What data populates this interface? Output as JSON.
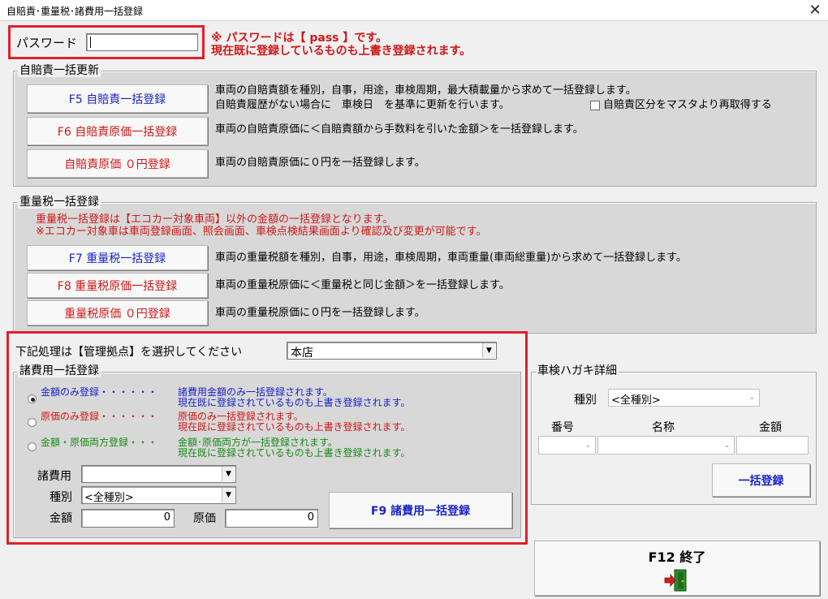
{
  "window": {
    "title": "自賠責･重量税･諸費用一括登録",
    "close_glyph": "✕"
  },
  "password": {
    "label": "パスワード",
    "value": "",
    "note_line1": "※ パスワードは【 pass 】です。",
    "note_line2": "現在既に登録しているものも上書き登録されます。"
  },
  "jibaiseki": {
    "legend": "自賠責一括更新",
    "f5_label": "F5 自賠責一括登録",
    "f6_label": "F6 自賠責原価一括登録",
    "zero_label": "自賠責原価 ０円登録",
    "desc_f5_line1": "車両の自賠責額を種別，自事，用途，車検周期，最大積載量から求めて一括登録します。",
    "desc_f5_line2": "自賠責履歴がない場合に　車検日　を基準に更新を行います。",
    "checkbox_label": "自賠責区分をマスタより再取得する",
    "checkbox_checked": false,
    "desc_f6": "車両の自賠責原価に＜自賠責額から手数料を引いた金額＞を一括登録します。",
    "desc_zero": "車両の自賠責原価に０円を一括登録します。"
  },
  "juryozei": {
    "legend": "重量税一括登録",
    "warning_line1": "重量税一括登録は【エコカー対象車両】以外の金額の一括登録となります。",
    "warning_line2": "※エコカー対象車は車両登録画面、照会画面、車検点検結果画面より確認及び変更が可能です。",
    "f7_label": "F7 重量税一括登録",
    "f8_label": "F8 重量税原価一括登録",
    "zero_label": "重量税原価 ０円登録",
    "desc_f7": "車両の重量税額を種別，自事，用途，車検周期，車両重量(車両総重量)から求めて一括登録します。",
    "desc_f8": "車両の重量税原価に＜重量税と同じ金額＞を一括登録します。",
    "desc_zero": "車両の重量税原価に０円を一括登録します。"
  },
  "kyoten": {
    "label": "下記処理は【管理拠点】を選択してください",
    "selected": "本店"
  },
  "shohiyo": {
    "legend": "諸費用一括登録",
    "options": [
      {
        "label": "金額のみ登録・・・・・・",
        "desc1": "諸費用金額のみ一括登録されます。",
        "desc2": "現在既に登録されているものも上書き登録されます。",
        "selected": true
      },
      {
        "label": "原価のみ登録・・・・・・",
        "desc1": "原価のみ一括登録されます。",
        "desc2": "現在既に登録されているものも上書き登録されます。",
        "selected": false
      },
      {
        "label": "金額・原価両方登録・・・",
        "desc1": "金額･原価両方が一括登録されます。",
        "desc2": "現在既に登録されているものも上書き登録されます。",
        "selected": false
      }
    ],
    "shohiyo_label": "諸費用",
    "shohiyo_value": "",
    "shubetsu_label": "種別",
    "shubetsu_value": "<全種別>",
    "kingaku_label": "金額",
    "kingaku_value": "0",
    "genka_label": "原価",
    "genka_value": "0",
    "f9_label": "F9 諸費用一括登録"
  },
  "shaken": {
    "legend": "車検ハガキ詳細",
    "shubetsu_label": "種別",
    "shubetsu_value": "<全種別>",
    "bango_label": "番号",
    "meisho_label": "名称",
    "kingaku_label": "金額",
    "bango_value": "",
    "meisho_value": "",
    "kingaku_value": "",
    "bulk_label": "一括登録"
  },
  "exit": {
    "label": "F12 終了",
    "icon": "exit-door-icon"
  },
  "colors": {
    "highlight": "#e0202a",
    "blue": "#1a24c8",
    "red": "#d01818",
    "green": "#1a8a1a"
  }
}
